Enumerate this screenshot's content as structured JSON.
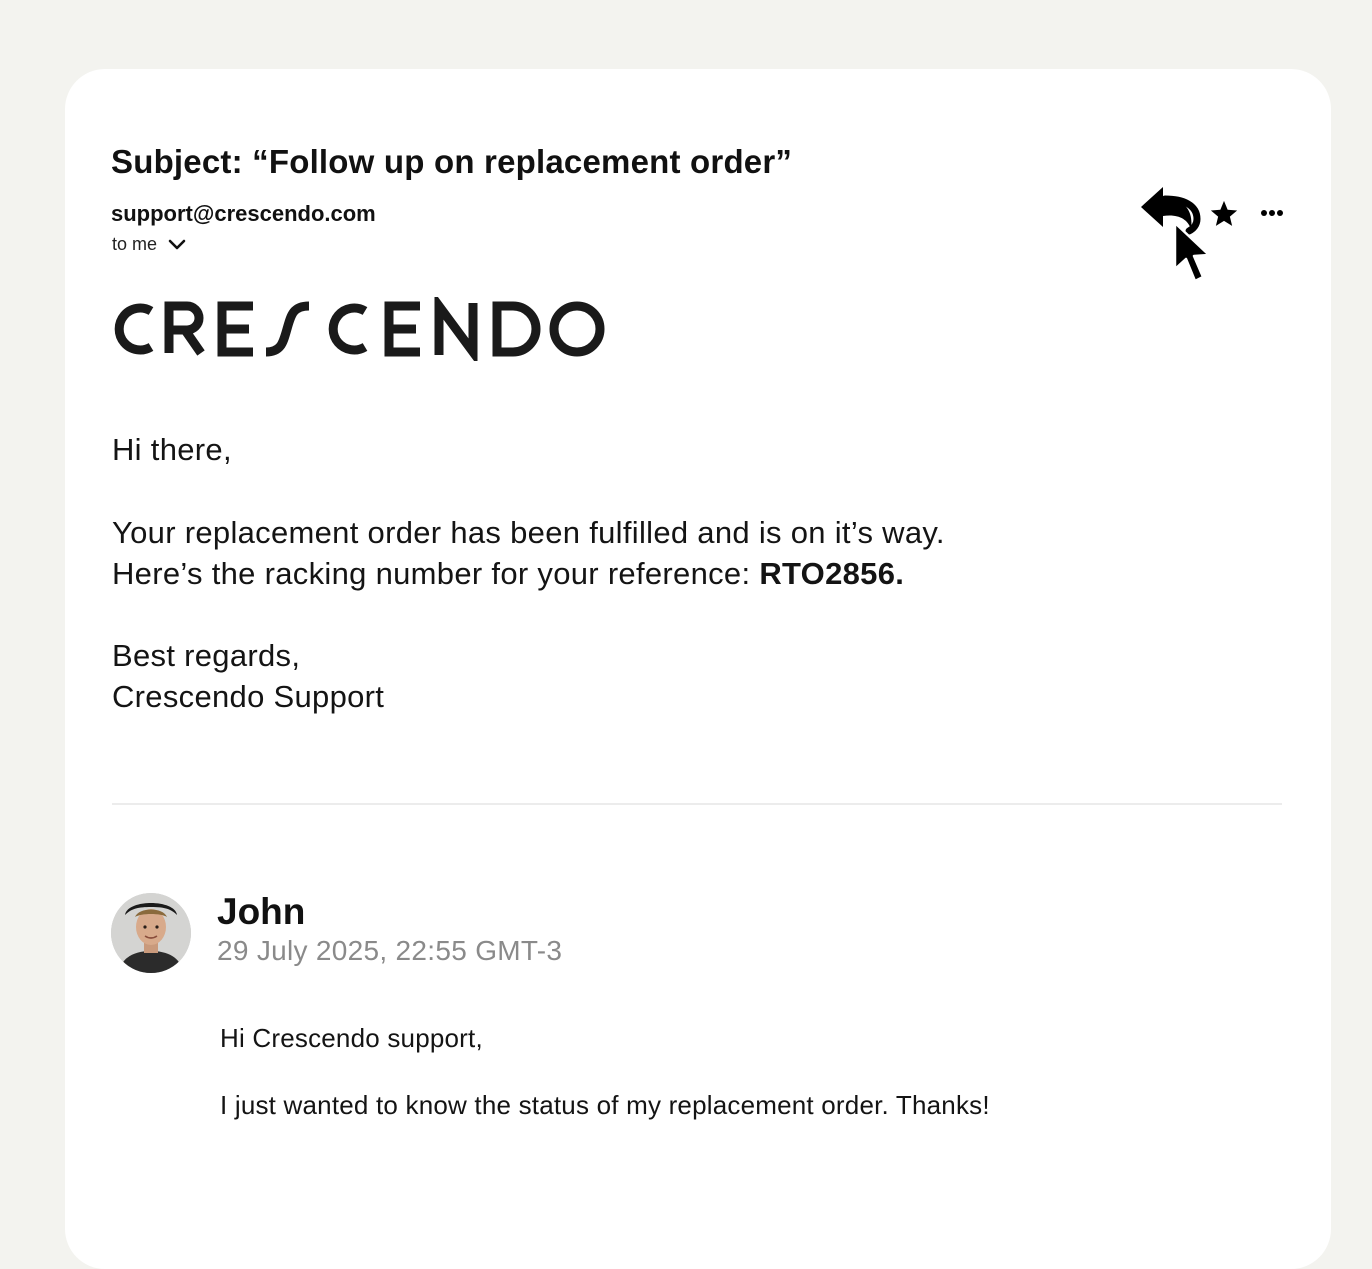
{
  "email": {
    "subject": "Subject: “Follow up on replacement order”",
    "sender": "support@crescendo.com",
    "recipient": "to me",
    "logo_text": "CRESCENDO",
    "body": {
      "greeting": "Hi there,",
      "line1": "Your replacement order has been fulfilled and is on it’s way.",
      "line2_prefix": "Here’s the racking number for your reference: ",
      "tracking_number": "RTO2856.",
      "signoff": "Best regards,",
      "signature": "Crescendo Support"
    }
  },
  "actions": {
    "reply_icon": "reply-icon",
    "star_icon": "star-icon",
    "more_icon": "more-horizontal-icon",
    "cursor_icon": "mouse-pointer-icon"
  },
  "thread_reply": {
    "name": "John",
    "date": "29 July 2025, 22:55 GMT-3",
    "line1": "Hi Crescendo support,",
    "line2": "I just wanted to know the status of my replacement order. Thanks!"
  },
  "colors": {
    "page_bg": "#f3f3ef",
    "card_bg": "#ffffff",
    "text": "#141414",
    "muted": "#8a8a8a"
  }
}
